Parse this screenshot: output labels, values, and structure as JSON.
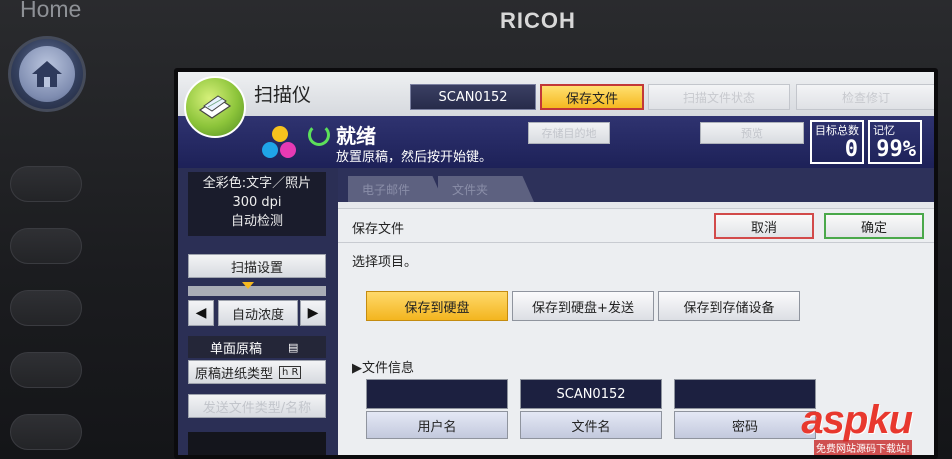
{
  "device": {
    "home_label": "Home",
    "brand": "RICOH"
  },
  "header": {
    "app_title": "扫描仪",
    "tab_scan": "SCAN0152",
    "tab_save": "保存文件",
    "tab_dim_1": "扫描文件状态",
    "tab_dim_2": "检查修订"
  },
  "status": {
    "ready": "就绪",
    "hint": "放置原稿，然后按开始键。",
    "ghost_btn_1": "存储目的地",
    "ghost_btn_2": "预览",
    "total_label": "目标总数",
    "total_value": "0",
    "memory_label": "记忆",
    "memory_value": "99%"
  },
  "left": {
    "mode_line1": "全彩色:文字／照片",
    "mode_line2": "300 dpi",
    "mode_line3": "自动检测",
    "scan_settings": "扫描设置",
    "density_label": "自动浓度",
    "single_side": "单面原稿",
    "feed_type": "原稿进纸类型",
    "dim_btn": "发送文件类型/名称"
  },
  "main": {
    "tab_1": "电子邮件",
    "tab_2": "文件夹",
    "panel_title": "保存文件",
    "cancel": "取消",
    "ok": "确定",
    "select_label": "选择项目。",
    "opt_1": "保存到硬盘",
    "opt_2": "保存到硬盘+发送",
    "opt_3": "保存到存储设备",
    "file_info": "▶文件信息",
    "user_value": "",
    "file_value": "SCAN0152",
    "pwd_value": "",
    "user_btn": "用户名",
    "file_btn": "文件名",
    "pwd_btn": "密码"
  },
  "watermark": {
    "brand": "aspku",
    "sub": "免费网站源码下载站!"
  },
  "colors": {
    "accent_selected": "#f5b820",
    "status_bar": "#2f3370",
    "ready_green": "#5ce05a"
  }
}
